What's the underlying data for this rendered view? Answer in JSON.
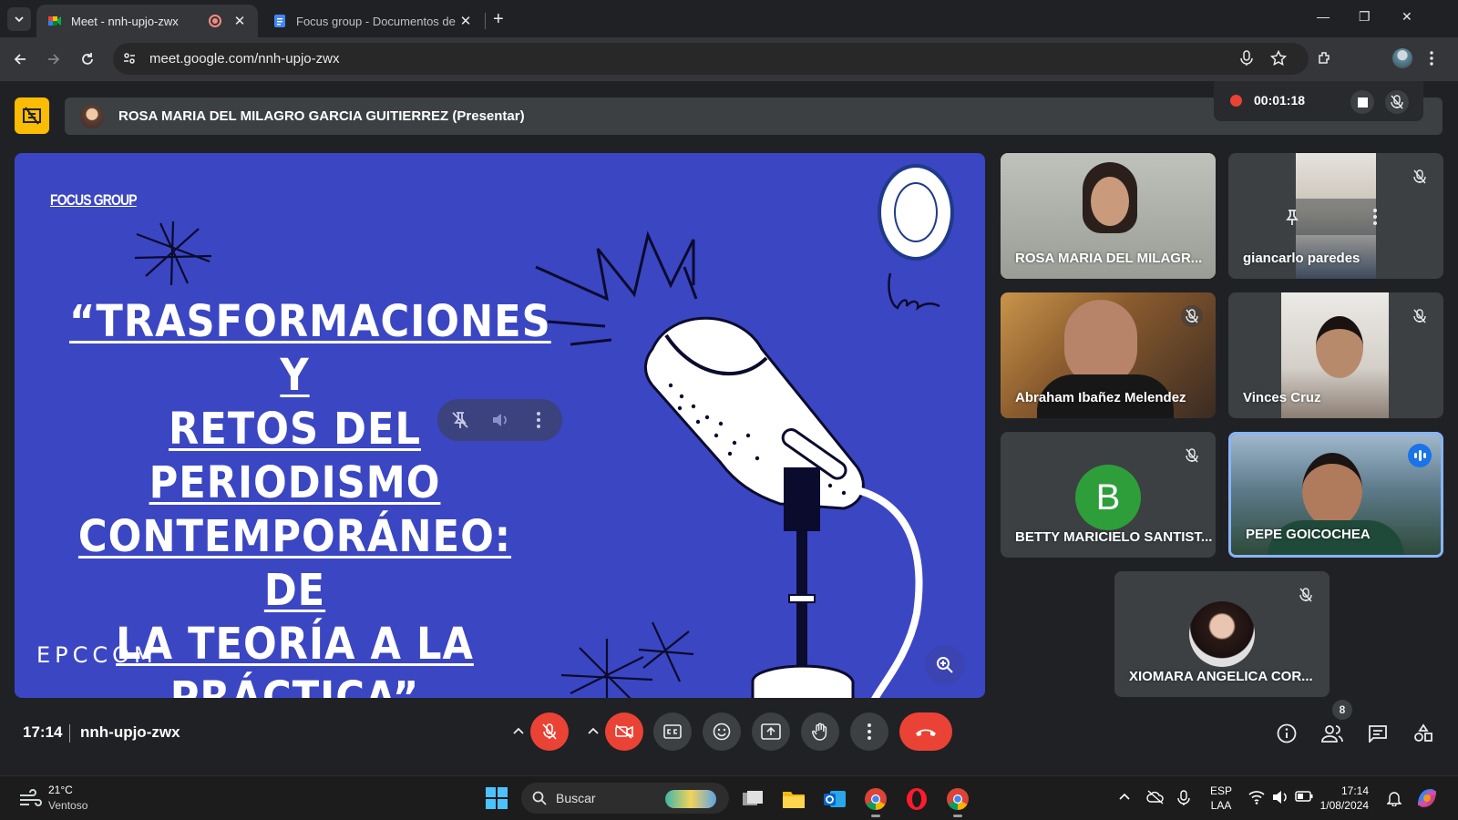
{
  "browser": {
    "tabs": [
      {
        "title": "Meet - nnh-upjo-zwx",
        "active": true
      },
      {
        "title": "Focus group - Documentos de",
        "active": false
      }
    ],
    "url": "meet.google.com/nnh-upjo-zwx"
  },
  "meet": {
    "presenter": "ROSA MARIA DEL MILAGRO GARCIA GUITIERREZ (Presentar)",
    "recording_time": "00:01:18",
    "slide": {
      "tag": "FOCUS GROUP",
      "headline_lines": [
        "“TRASFORMACIONES Y",
        "RETOS DEL",
        "PERIODISMO",
        "CONTEMPORÁNEO: DE",
        "LA TEORÍA A LA",
        "PRÁCTICA”"
      ],
      "brand": "EPCCOM"
    },
    "participants": [
      {
        "name": "ROSA MARIA DEL MILAGR...",
        "muted": false
      },
      {
        "name": "giancarlo paredes",
        "muted": true
      },
      {
        "name": "Abraham Ibañez Melendez",
        "muted": true
      },
      {
        "name": "Vinces Cruz",
        "muted": true
      },
      {
        "name": "BETTY MARICIELO SANTIST...",
        "muted": true,
        "initial": "B"
      },
      {
        "name": "PEPE GOICOCHEA",
        "muted": false,
        "speaking": true
      },
      {
        "name": "XIOMARA ANGELICA COR...",
        "muted": true
      }
    ],
    "clock": "17:14",
    "meeting_code": "nnh-upjo-zwx",
    "people_count": "8"
  },
  "taskbar": {
    "temperature": "21°C",
    "weather": "Ventoso",
    "search_placeholder": "Buscar",
    "lang_top": "ESP",
    "lang_bottom": "LAA",
    "time": "17:14",
    "date": "1/08/2024"
  },
  "colors": {
    "slide_bg": "#3b46c3",
    "end_call": "#ea4335",
    "present_icon": "#fbbc04",
    "speaking_border": "#8ab4f8"
  }
}
